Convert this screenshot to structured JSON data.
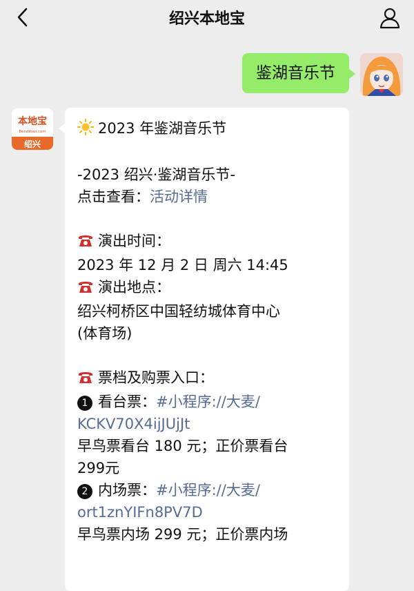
{
  "header": {
    "title": "绍兴本地宝",
    "back_icon": "chevron-left-icon",
    "user_icon": "person-icon"
  },
  "outgoing": {
    "text": "鉴湖音乐节",
    "bubble_color": "#95ec69"
  },
  "incoming": {
    "avatar": {
      "brand_top": "本地宝",
      "brand_small": "Bendibao.com",
      "city": "绍兴",
      "accent": "#e8692a"
    },
    "title": "2023 年鉴湖音乐节",
    "subtitle": "-2023 绍兴·鉴湖音乐节-",
    "view_prefix": "点击查看：",
    "view_link": "活动详情",
    "time_label": "演出时间：",
    "time_value": "2023 年 12 月 2 日 周六 14:45",
    "place_label": "演出地点：",
    "place_value_1": "绍兴柯桥区中国轻纺城体育中心",
    "place_value_2": "(体育场)",
    "ticket_label": "票档及购票入口：",
    "ticket1_num": "1",
    "ticket1_label": "看台票：",
    "ticket1_link_1": "#小程序://大麦/",
    "ticket1_link_2": "KCKV70X4ijJUjJt",
    "ticket1_price_1": "早鸟票看台 180 元；正价票看台",
    "ticket1_price_2": "299元",
    "ticket2_num": "2",
    "ticket2_label": "内场票：",
    "ticket2_link_1": "#小程序://大麦/",
    "ticket2_link_2": "ort1znYIFn8PV7D",
    "ticket2_price_1": "早鸟票内场 299 元；正价票内场",
    "link_color": "#576b95"
  }
}
